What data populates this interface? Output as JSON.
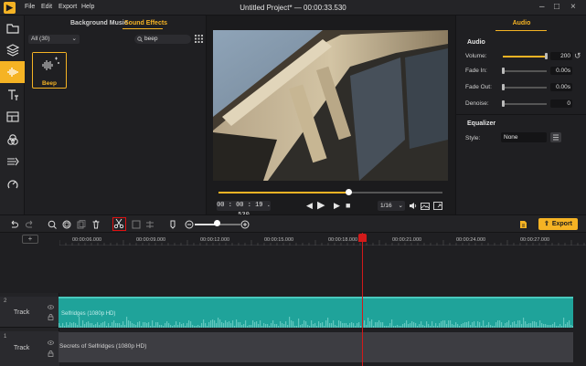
{
  "app": {
    "title": "Untitled Project* — 00:00:33.530",
    "menu": [
      "File",
      "Edit",
      "Export",
      "Help"
    ],
    "accent": "#f5b324"
  },
  "sidebar": {
    "icons": [
      "folder-icon",
      "layers-icon",
      "audio-wave-icon",
      "text-icon",
      "template-icon",
      "filter-icon",
      "transition-icon",
      "motion-icon"
    ],
    "active": "audio-wave-icon"
  },
  "library": {
    "tabs": [
      "Background Music",
      "Sound Effects"
    ],
    "active_tab": "Sound Effects",
    "filter": "All (30)",
    "search_value": "beep",
    "items": [
      {
        "label": "Beep"
      }
    ]
  },
  "preview": {
    "timecode": "00 : 00 : 19 . 530",
    "progress": 0.58,
    "zoom": "1/16"
  },
  "properties": {
    "tab": "Audio",
    "section_audio": "Audio",
    "volume_label": "Volume:",
    "volume_value": "200",
    "volume_fraction": 1.0,
    "fade_in_label": "Fade In:",
    "fade_in_value": "0.00s",
    "fade_out_label": "Fade Out:",
    "fade_out_value": "0.00s",
    "denoise_label": "Denoise:",
    "denoise_value": "0",
    "section_equalizer": "Equalizer",
    "style_label": "Style:",
    "style_value": "None"
  },
  "toolbar": {
    "export_label": "Export"
  },
  "timeline": {
    "ticks": [
      "00:00:06.000",
      "00:00:09.000",
      "00:00:12.000",
      "00:00:15.000",
      "00:00:18.000",
      "00:00:21.000",
      "00:00:24.000",
      "00:00:27.000"
    ],
    "tracks": [
      {
        "number": "2",
        "label": "Track",
        "clip": "Selfridges (1080p HD)"
      },
      {
        "number": "1",
        "label": "Track",
        "clip": "Secrets of Selfridges (1080p HD)"
      }
    ]
  }
}
